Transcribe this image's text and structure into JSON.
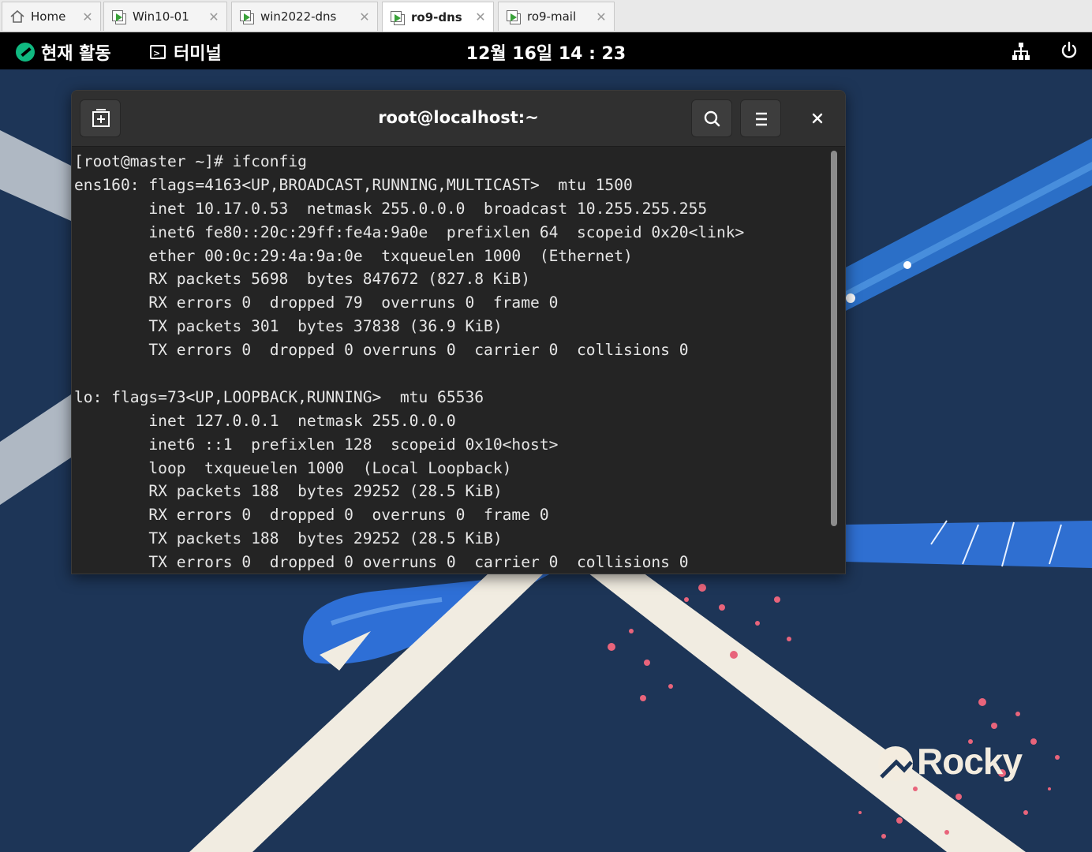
{
  "tabs": [
    {
      "label": "Home",
      "icon": "home-icon",
      "active": false
    },
    {
      "label": "Win10-01",
      "icon": "vm-icon",
      "active": false
    },
    {
      "label": "win2022-dns",
      "icon": "vm-icon",
      "active": false
    },
    {
      "label": "ro9-dns",
      "icon": "vm-icon",
      "active": true
    },
    {
      "label": "ro9-mail",
      "icon": "vm-icon",
      "active": false
    }
  ],
  "topbar": {
    "activities": "현재 활동",
    "app": "터미널",
    "clock": "12월 16일  14 : 23"
  },
  "terminal": {
    "title": "root@localhost:~",
    "lines": [
      "[root@master ~]# ifconfig",
      "ens160: flags=4163<UP,BROADCAST,RUNNING,MULTICAST>  mtu 1500",
      "        inet 10.17.0.53  netmask 255.0.0.0  broadcast 10.255.255.255",
      "        inet6 fe80::20c:29ff:fe4a:9a0e  prefixlen 64  scopeid 0x20<link>",
      "        ether 00:0c:29:4a:9a:0e  txqueuelen 1000  (Ethernet)",
      "        RX packets 5698  bytes 847672 (827.8 KiB)",
      "        RX errors 0  dropped 79  overruns 0  frame 0",
      "        TX packets 301  bytes 37838 (36.9 KiB)",
      "        TX errors 0  dropped 0 overruns 0  carrier 0  collisions 0",
      "",
      "lo: flags=73<UP,LOOPBACK,RUNNING>  mtu 65536",
      "        inet 127.0.0.1  netmask 255.0.0.0",
      "        inet6 ::1  prefixlen 128  scopeid 0x10<host>",
      "        loop  txqueuelen 1000  (Local Loopback)",
      "        RX packets 188  bytes 29252 (28.5 KiB)",
      "        RX errors 0  dropped 0  overruns 0  frame 0",
      "        TX packets 188  bytes 29252 (28.5 KiB)",
      "        TX errors 0  dropped 0 overruns 0  carrier 0  collisions 0"
    ]
  },
  "wallpaper": {
    "logo": "Rocky"
  },
  "colors": {
    "desktop": "#1d3557",
    "rocky_green": "#10b981",
    "terminal_bg": "#242424",
    "header_bg": "#303030"
  }
}
